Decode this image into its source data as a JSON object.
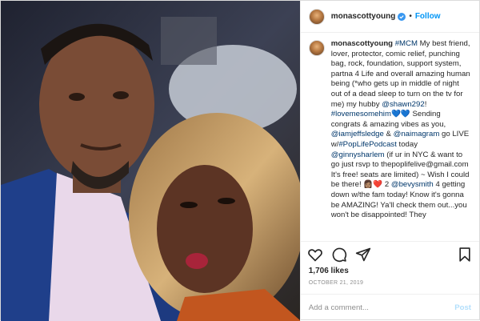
{
  "post": {
    "username": "monascottyoung",
    "follow_label": "Follow",
    "separator": "•",
    "caption": {
      "username": "monascottyoung",
      "segments": [
        {
          "text": "#MCM",
          "link": true
        },
        {
          "text": " My best friend, lover, protector, comic relief, punching bag, rock, foundation, support system, partna 4 Life and overall amazing human being (*who gets up in middle of night out of a dead sleep to turn on the tv for me) my hubby ",
          "link": false
        },
        {
          "text": "@shawn292",
          "link": true
        },
        {
          "text": "! ",
          "link": false
        },
        {
          "text": "#lovemesomehim",
          "link": true
        },
        {
          "text": "💙💙 Sending congrats & amazing vibes as you, ",
          "link": false
        },
        {
          "text": "@iamjeffsledge",
          "link": true
        },
        {
          "text": " & ",
          "link": false
        },
        {
          "text": "@naimagram",
          "link": true
        },
        {
          "text": " go LIVE w/",
          "link": false
        },
        {
          "text": "#PopLifePodcast",
          "link": true
        },
        {
          "text": " today ",
          "link": false
        },
        {
          "text": "@ginnysharlem",
          "link": true
        },
        {
          "text": " (if ur in NYC & want to go just rsvp to thepoplifelive@gmail.com It's free! seats are limited) ~ Wish I could be there! 👩🏽‍❤️ 2 ",
          "link": false
        },
        {
          "text": "@bevysmith",
          "link": true
        },
        {
          "text": " 4 getting down w/the fam today! Know it's gonna be AMAZING! Ya'll check them out...you won't be disappointed! They",
          "link": false
        }
      ]
    },
    "likes": "1,706 likes",
    "date": "October 21, 2019",
    "comment_placeholder": "Add a comment...",
    "post_label": "Post",
    "colors": {
      "link": "#00376b",
      "follow": "#0095f6",
      "verified": "#3897f0",
      "post_disabled": "#b2dffc"
    },
    "icons": [
      "heart-icon",
      "comment-icon",
      "share-icon",
      "bookmark-icon",
      "verified-badge-icon"
    ]
  }
}
